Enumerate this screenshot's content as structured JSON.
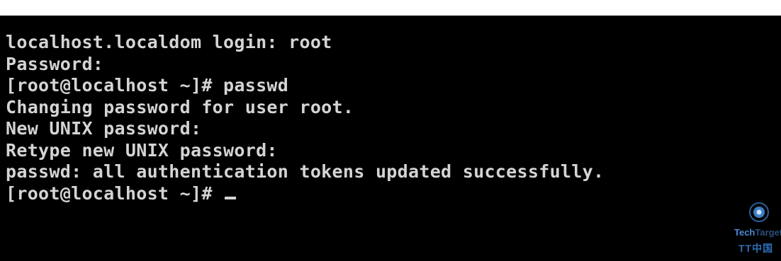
{
  "terminal": {
    "lines": [
      "localhost.localdom login: root",
      "Password:",
      "[root@localhost ~]# passwd",
      "Changing password for user root.",
      "New UNIX password:",
      "Retype new UNIX password:",
      "passwd: all authentication tokens updated successfully.",
      "[root@localhost ~]# "
    ]
  },
  "watermark": {
    "brand_a": "Tech",
    "brand_b": "Target",
    "sub": "TT中国",
    "icon": "eye-icon"
  },
  "colors": {
    "background": "#000000",
    "text": "#d4d4d4",
    "watermark_blue": "#4a8ad0"
  }
}
